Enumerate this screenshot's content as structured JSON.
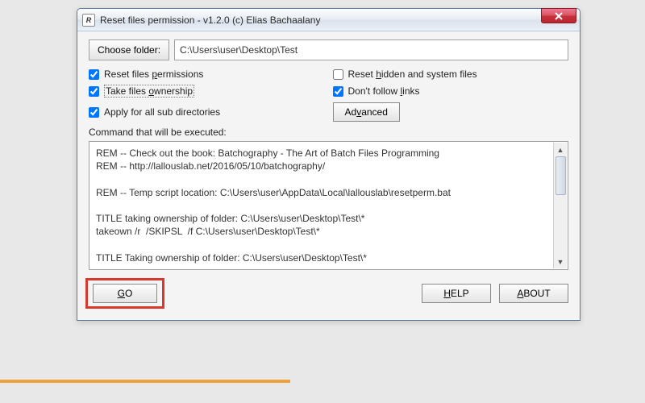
{
  "window": {
    "title": "Reset files permission - v1.2.0 (c) Elias Bachaalany",
    "app_icon_letter": "R"
  },
  "toolbar": {
    "choose_folder_label": "Choose folder:",
    "path_value": "C:\\Users\\user\\Desktop\\Test"
  },
  "options": {
    "reset_permissions": {
      "checked": true,
      "pre": "Reset files ",
      "ul": "p",
      "post": "ermissions"
    },
    "reset_hidden": {
      "checked": false,
      "pre": "Reset ",
      "ul": "h",
      "post": "idden and system files"
    },
    "take_ownership": {
      "checked": true,
      "pre": "Take files ",
      "ul": "o",
      "post": "wnership"
    },
    "dont_follow_links": {
      "checked": true,
      "pre": "Don't follow ",
      "ul": "l",
      "post": "inks"
    },
    "apply_subdirs": {
      "checked": true,
      "pre": "Apply for all sub directories",
      "ul": "",
      "post": ""
    },
    "advanced_pre": "Ad",
    "advanced_ul": "v",
    "advanced_post": "anced"
  },
  "command": {
    "label": "Command that will be executed:",
    "text": "REM -- Check out the book: Batchography - The Art of Batch Files Programming\nREM -- http://lallouslab.net/2016/05/10/batchography/\n\nREM -- Temp script location: C:\\Users\\user\\AppData\\Local\\lallouslab\\resetperm.bat\n\nTITLE taking ownership of folder: C:\\Users\\user\\Desktop\\Test\\*\ntakeown /r  /SKIPSL  /f C:\\Users\\user\\Desktop\\Test\\*\n\nTITLE Taking ownership of folder: C:\\Users\\user\\Desktop\\Test\\*"
  },
  "buttons": {
    "go_ul": "G",
    "go_post": "O",
    "help_ul": "H",
    "help_post": "ELP",
    "about_ul": "A",
    "about_post": "BOUT"
  }
}
